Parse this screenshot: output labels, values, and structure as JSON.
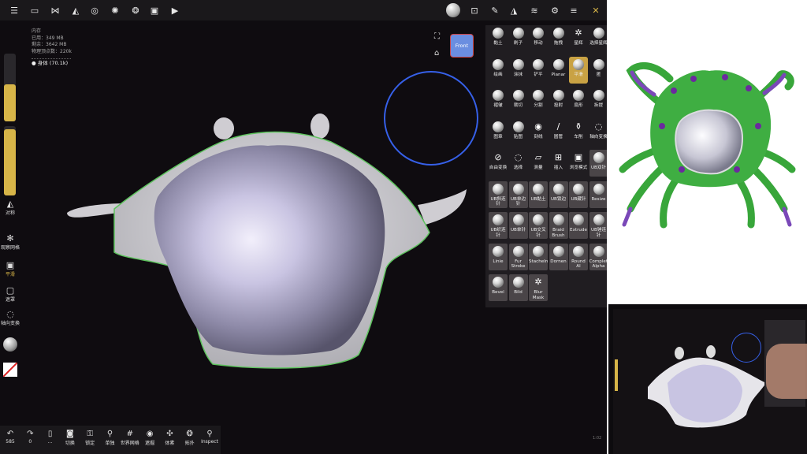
{
  "stats": {
    "title": "内存",
    "used": "已用：349 MB",
    "remaining": "剩余：3642 MB",
    "vertices": "物理顶点数：220k",
    "body": "身体 (70.1k)"
  },
  "viewcube": {
    "label": "Front"
  },
  "left_sidebar": [
    {
      "label": "对称",
      "icon": "symmetry-icon"
    },
    {
      "label": "观察网格",
      "icon": "grid-icon"
    },
    {
      "label": "平滑",
      "icon": "smooth-icon"
    },
    {
      "label": "遮罩",
      "icon": "mask-icon"
    },
    {
      "label": "轴向变换",
      "icon": "axis-icon"
    }
  ],
  "sliders": [
    {
      "name": "radius",
      "level": 0.55
    },
    {
      "name": "intensity",
      "level": 0.95
    }
  ],
  "tools": {
    "rows": [
      [
        "黏土",
        "刷子",
        "移动",
        "拖拽",
        "星辉",
        "选择星辉"
      ],
      [
        "绘画",
        "涂抹",
        "铲平",
        "Planar",
        "平滑",
        "匿"
      ],
      [
        "褶皱",
        "裁切",
        "分割",
        "投射",
        "扇形",
        "拆提"
      ],
      [
        "图章",
        "贴图",
        "刻线",
        "圆管",
        "车削",
        "轴向变换"
      ],
      [
        "自由变换",
        "选择",
        "测量",
        "插入",
        "浏览模式",
        "UB双针"
      ],
      [
        "UB斜连针",
        "UB单边针",
        "UB黏土",
        "UB锁边",
        "UB藏针",
        "Resize"
      ],
      [
        "UB织连针",
        "UB单针",
        "UB交叉针",
        "Braid Brush",
        "Extrude",
        "UB锤连针"
      ],
      [
        "Linie",
        "Fur Stroke",
        "Stacheln",
        "Dornen",
        "Round Al",
        "Complete Alpha"
      ],
      [
        "Bevel",
        "Bild",
        "Blur Mask"
      ]
    ],
    "selected": "平滑"
  },
  "bottom_toolbar": [
    {
      "label": "585",
      "icon": "undo-icon"
    },
    {
      "label": "0",
      "icon": "redo-icon"
    },
    {
      "label": "...",
      "icon": "file-icon"
    },
    {
      "label": "切换",
      "icon": "camera-icon"
    },
    {
      "label": "锁定",
      "icon": "lock-icon"
    },
    {
      "label": "单独",
      "icon": "search-icon"
    },
    {
      "label": "世界网格",
      "icon": "grid-icon"
    },
    {
      "label": "遮掘",
      "icon": "eye-icon"
    },
    {
      "label": "体素",
      "icon": "voxel-icon"
    },
    {
      "label": "拓扑",
      "icon": "topology-icon"
    },
    {
      "label": "Inspect",
      "icon": "inspect-icon"
    }
  ],
  "pip": {
    "label": "1:02"
  },
  "colors": {
    "accent": "#c9a244",
    "brush_circle": "#3660e8",
    "panel": "#201d21"
  }
}
